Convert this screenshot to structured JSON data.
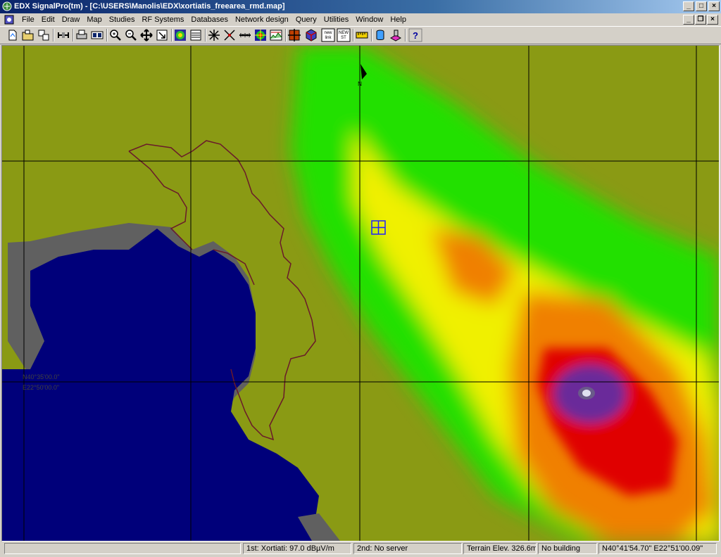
{
  "window": {
    "title": "EDX SignalPro(tm) - [C:\\USERS\\Manolis\\EDX\\xortiatis_freearea_rmd.map]",
    "min_label": "_",
    "max_label": "□",
    "close_label": "×",
    "restore_label": "❐"
  },
  "menu": [
    "File",
    "Edit",
    "Draw",
    "Map",
    "Studies",
    "RF Systems",
    "Databases",
    "Network design",
    "Query",
    "Utilities",
    "Window",
    "Help"
  ],
  "toolbar": {
    "icons": [
      "new-icon",
      "open-icon",
      "save-icon",
      "link-icon",
      "print-icon",
      "print-preview-icon",
      "zoom-in-icon",
      "zoom-out-icon",
      "pan-icon",
      "zoom-window-icon",
      "globe-icon",
      "layers-icon",
      "site-icon",
      "crosshair-icon",
      "ruler-icon",
      "coverage-icon",
      "profile-icon",
      "target-icon",
      "cube-icon",
      "new-link-icon",
      "new-site-icon",
      "scale-icon",
      "cylinder-icon",
      "building-icon",
      "help-icon"
    ],
    "new_link_label": "new link",
    "new_site_label": "NEW ST"
  },
  "map": {
    "north_label": "N",
    "coord_lat": "N40°35'00.0\"",
    "coord_lon": "E22°50'00.0\"",
    "colors": {
      "water": "#00007a",
      "land": "#8a9a14",
      "high_green": "#22e000",
      "yellow": "#f0f000",
      "orange": "#f08000",
      "red": "#e00000",
      "purple": "#6a2a9a",
      "border": "#6a1a2a",
      "grid": "#000000",
      "gray": "#606060"
    }
  },
  "status": {
    "panel0": "",
    "first": "1st:  Xortiati:  97.0 dBµV/m",
    "second": "2nd:  No server",
    "terrain": "Terrain Elev. 326.6m",
    "building": "No building",
    "coords": "N40°41'54.70\" E22°51'00.09\""
  }
}
